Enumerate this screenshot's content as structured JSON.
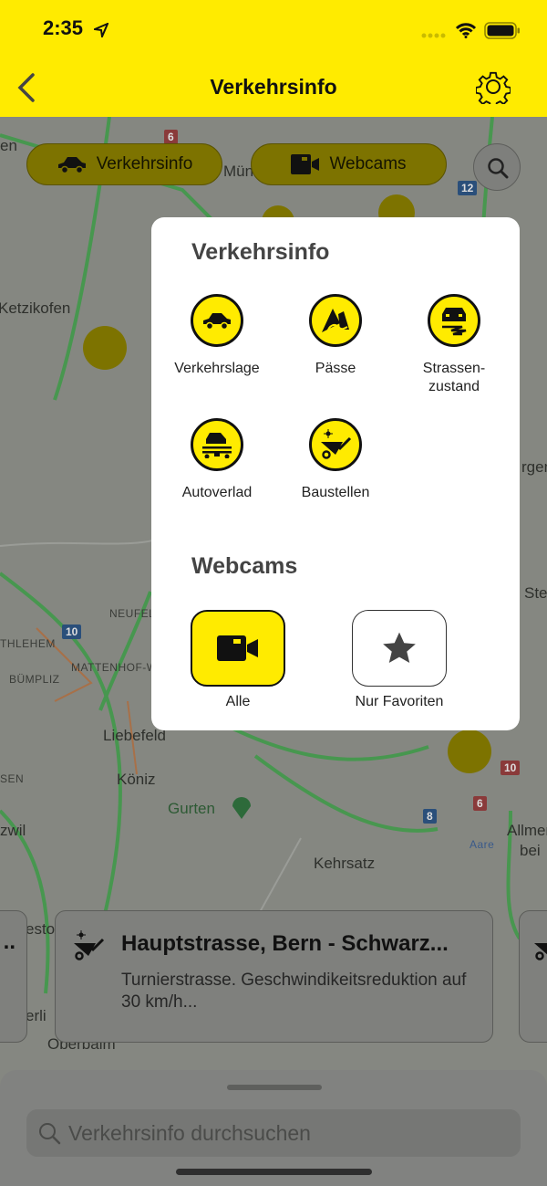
{
  "status_bar": {
    "time": "2:35"
  },
  "header": {
    "title": "Verkehrsinfo",
    "back_icon": "chevron-left-icon",
    "settings_icon": "gear-icon"
  },
  "filters": [
    {
      "label": "Verkehrsinfo",
      "icon": "car-icon"
    },
    {
      "label": "Webcams",
      "icon": "video-camera-icon"
    }
  ],
  "map": {
    "labels": [
      "Ketzikofen",
      "NEUFELD",
      "THLEHEM",
      "BÜMPLIZ",
      "MATTENHOF-W",
      "Liebefeld",
      "Köniz",
      "Gurten",
      "Kehrsatz",
      "Allmen",
      "bei",
      "Aare",
      "zwil",
      "SEN",
      "Ste",
      "rgen",
      "Oberbalm",
      "Mün",
      "en",
      "esto",
      "erli"
    ],
    "shields": [
      "6",
      "12",
      "10",
      "10",
      "6",
      "8"
    ]
  },
  "popup": {
    "verkehrsinfo_title": "Verkehrsinfo",
    "categories": [
      {
        "label": "Verkehrslage",
        "icon": "car-icon"
      },
      {
        "label": "Pässe",
        "icon": "mountain-pass-icon"
      },
      {
        "label": "Strassen-\nzustand",
        "icon": "slippery-road-icon"
      },
      {
        "label": "Autoverlad",
        "icon": "car-train-icon"
      },
      {
        "label": "Baustellen",
        "icon": "wheelbarrow-icon"
      }
    ],
    "webcams_title": "Webcams",
    "webcam_options": [
      {
        "label": "Alle",
        "icon": "video-camera-icon",
        "selected": true
      },
      {
        "label": "Nur Favoriten",
        "icon": "star-icon",
        "selected": false
      }
    ]
  },
  "card": {
    "title": "Hauptstrasse, Bern - Schwarz...",
    "description": "Turnierstrasse. Geschwindikeitsreduktion auf 30 km/h...",
    "icon": "wheelbarrow-icon"
  },
  "search": {
    "placeholder": "Verkehrsinfo durchsuchen"
  },
  "colors": {
    "accent": "#ffeb00",
    "traffic_green": "#3fae4a"
  }
}
